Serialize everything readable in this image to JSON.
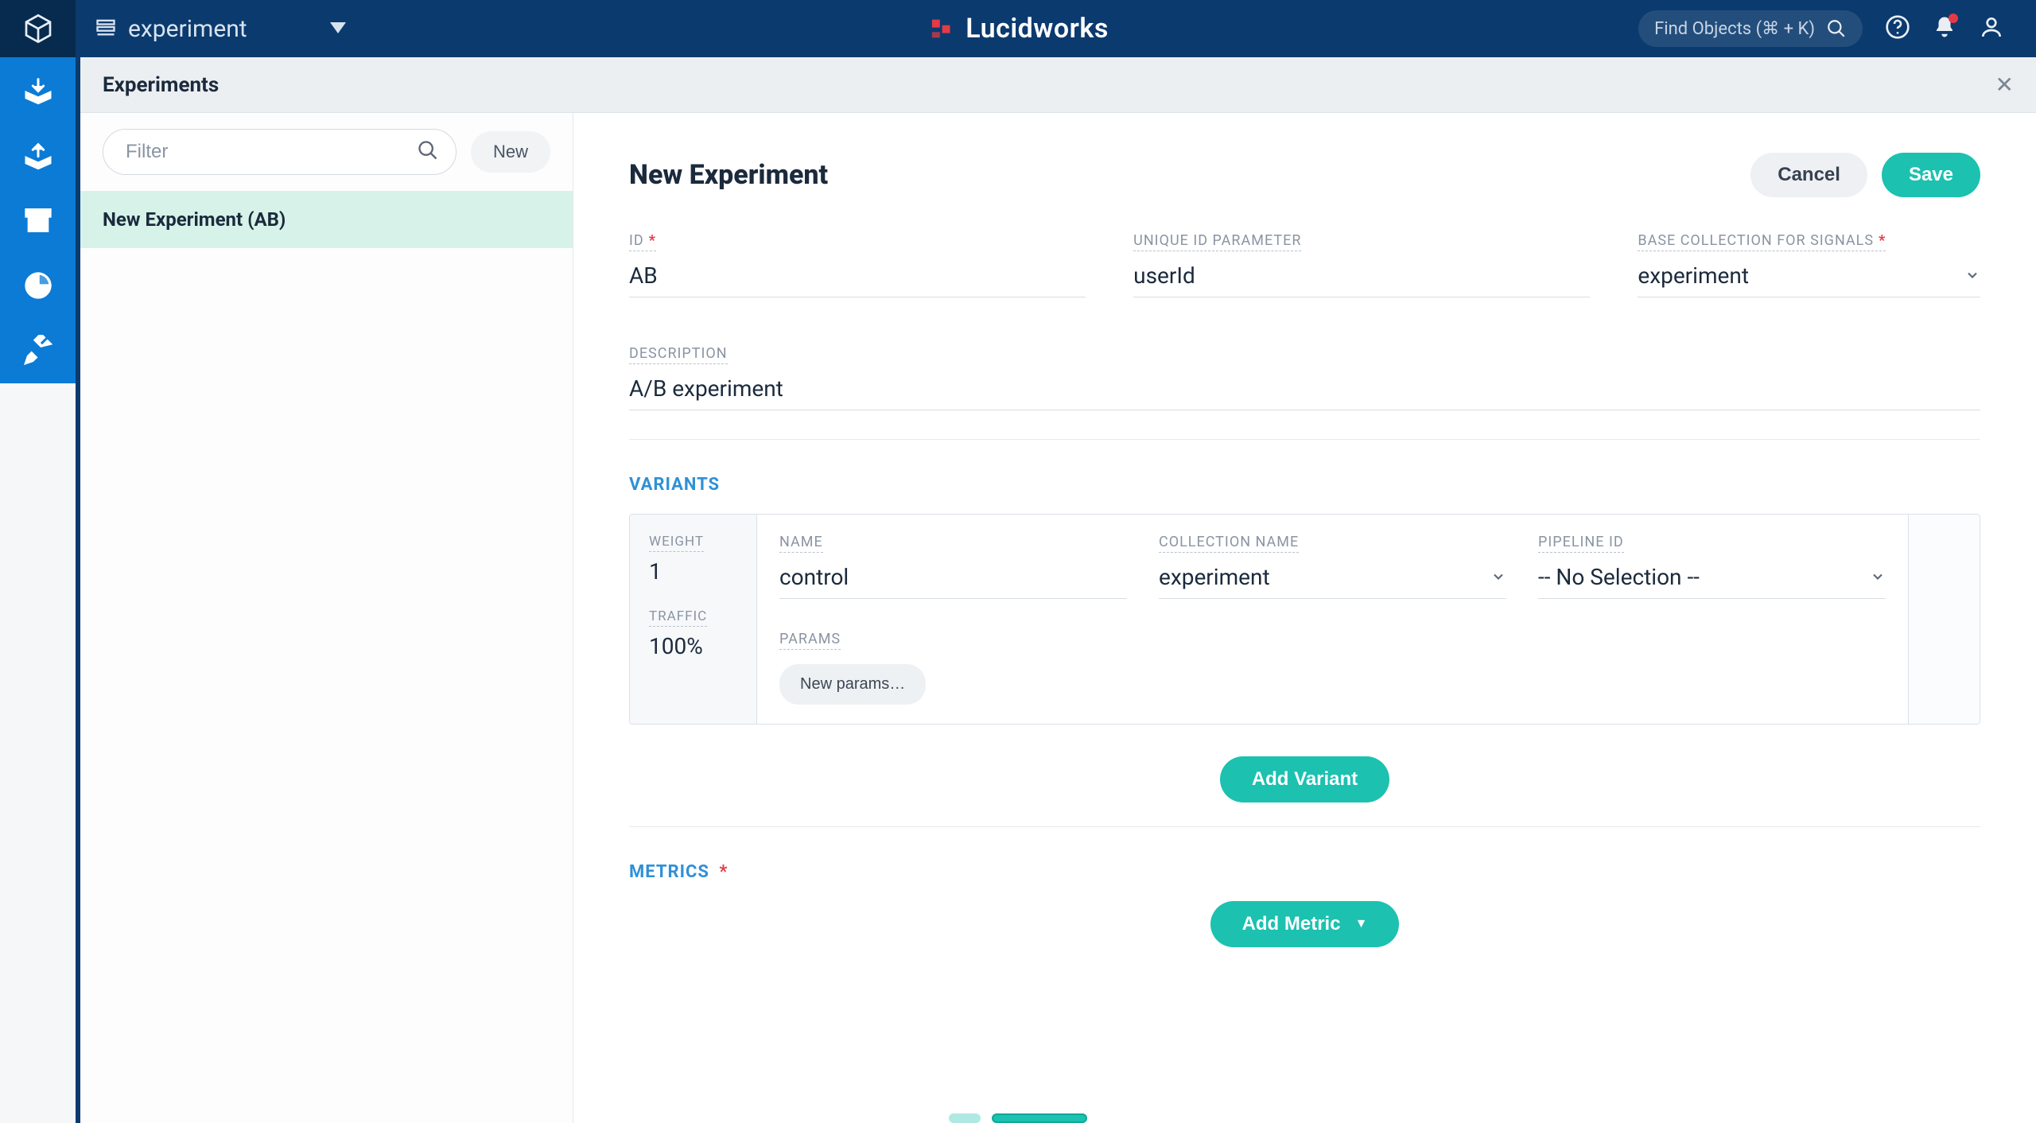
{
  "topbar": {
    "workspace_name": "experiment",
    "brand_name": "Lucidworks",
    "search_placeholder": "Find Objects (⌘ + K)"
  },
  "panel": {
    "title": "Experiments"
  },
  "list": {
    "filter_placeholder": "Filter",
    "new_button": "New",
    "items": [
      {
        "label": "New Experiment (AB)",
        "selected": true
      }
    ]
  },
  "form": {
    "title": "New Experiment",
    "cancel": "Cancel",
    "save": "Save",
    "fields": {
      "id_label": "ID",
      "id_value": "AB",
      "uid_label": "UNIQUE ID PARAMETER",
      "uid_value": "userId",
      "base_label": "BASE COLLECTION FOR SIGNALS",
      "base_value": "experiment",
      "desc_label": "DESCRIPTION",
      "desc_value": "A/B experiment"
    },
    "variants_title": "VARIANTS",
    "variant": {
      "weight_label": "WEIGHT",
      "weight_value": "1",
      "traffic_label": "TRAFFIC",
      "traffic_value": "100%",
      "name_label": "NAME",
      "name_value": "control",
      "collection_label": "COLLECTION NAME",
      "collection_value": "experiment",
      "pipeline_label": "PIPELINE ID",
      "pipeline_value": "-- No Selection --",
      "params_label": "PARAMS",
      "new_params": "New params…"
    },
    "add_variant": "Add Variant",
    "metrics_title": "METRICS",
    "add_metric": "Add Metric"
  }
}
